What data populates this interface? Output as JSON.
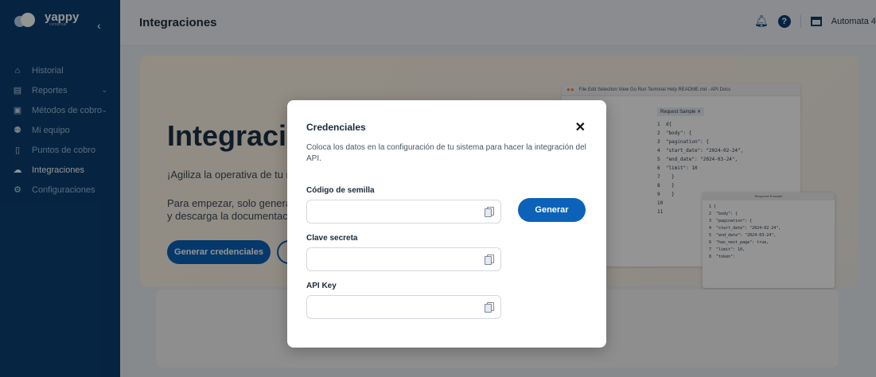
{
  "brand": {
    "name": "yappy",
    "sub": "comercial"
  },
  "sidebar": {
    "items": [
      {
        "label": "Historial",
        "icon": "home-icon",
        "glyph": "⌂"
      },
      {
        "label": "Reportes",
        "icon": "report-icon",
        "glyph": "▤",
        "chevron": "⌄"
      },
      {
        "label": "Métodos de cobro",
        "icon": "payment-methods-icon",
        "glyph": "▣",
        "chevron": "⌄"
      },
      {
        "label": "Mi equipo",
        "icon": "team-icon",
        "glyph": "⚉"
      },
      {
        "label": "Puntos de cobro",
        "icon": "pos-icon",
        "glyph": "▯"
      },
      {
        "label": "Integraciones",
        "icon": "cloud-icon",
        "glyph": "☁"
      },
      {
        "label": "Configuraciones",
        "icon": "gear-icon",
        "glyph": "⚙"
      }
    ],
    "active": "Integraciones"
  },
  "header": {
    "title": "Integraciones",
    "account": "Automata 4"
  },
  "hero": {
    "title": "Integracio",
    "line1": "¡Agiliza la operativa de tu ne",
    "line2": "Para empezar, solo genera",
    "line3": "y descarga la documentació",
    "button": "Generar credenciales"
  },
  "code_preview": {
    "menu": "File  Edit  Selection  View  Go  Run  Terminal  Help     README.md - API Docs",
    "tab": "Request Sample  ✕",
    "lines": "1  d{\n2  \"body\": {\n3  \"pagination\": {\n4  \"start_date\": \"2024-02-24\",\n5  \"end_date\": \"2024-03-24\",\n6  \"limit\": 10\n7    }\n8    }\n9    }\n10\n11",
    "response_title": "Response Example",
    "response_lines": "1 {\n2  \"body\": {\n3  \"pagination\": {\n4  \"start_date\": \"2024-02-24\",\n5  \"end_date\": \"2024-03-24\",\n6  \"has_next_page\": true,\n7  \"limit\": 10,\n8  \"token\":"
  },
  "modal": {
    "title": "Credenciales",
    "close": "✕",
    "description": "Coloca los datos en la configuración de tu sistema para hacer la integración del API.",
    "fields": [
      {
        "label": "Código de semilla",
        "value": ""
      },
      {
        "label": "Clave secreta",
        "value": ""
      },
      {
        "label": "API Key",
        "value": ""
      }
    ],
    "generate_button": "Generar"
  },
  "colors": {
    "sidebar_bg": "#0b3f71",
    "primary": "#0b62b8",
    "overlay": "rgba(0,0,0,0.42)"
  }
}
